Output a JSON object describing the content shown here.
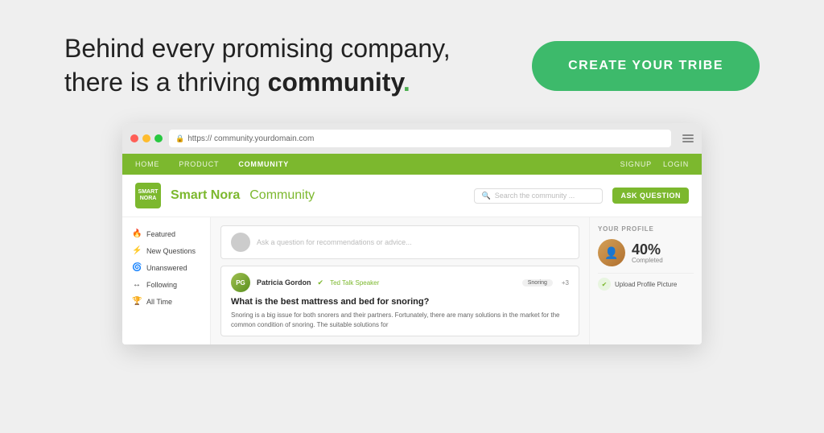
{
  "hero": {
    "headline_part1": "Behind every promising company,",
    "headline_part2": "there is a thriving ",
    "headline_bold": "community",
    "headline_dot": ".",
    "cta_label": "CREATE YOUR TRIBE"
  },
  "browser": {
    "url": "https:// community.yourdomain.com",
    "dots": [
      "red",
      "yellow",
      "green"
    ]
  },
  "site": {
    "logo_text": "SMART\nNORA",
    "title": "Smart Nora",
    "community_label": "Community",
    "search_placeholder": "Search the community ...",
    "ask_button": "ASK QUESTION",
    "nav": {
      "items": [
        {
          "label": "HOME",
          "active": false
        },
        {
          "label": "PRODUCT",
          "active": false
        },
        {
          "label": "COMMUNITY",
          "active": true
        }
      ],
      "right_items": [
        {
          "label": "SIGNUP",
          "active": false
        },
        {
          "label": "LOGIN",
          "active": false
        }
      ]
    },
    "sidebar": {
      "items": [
        {
          "icon": "🔥",
          "label": "Featured"
        },
        {
          "icon": "⚡",
          "label": "New Questions"
        },
        {
          "icon": "🌀",
          "label": "Unanswered"
        },
        {
          "icon": "↔",
          "label": "Following"
        },
        {
          "icon": "🏆",
          "label": "All Time"
        }
      ]
    },
    "ask_prompt": "Ask a question for recommendations or advice...",
    "question": {
      "author": "Patricia Gordon",
      "verified": true,
      "author_badge": "Ted Talk Speaker",
      "tag": "Snoring",
      "tag_extra": "+3",
      "title": "What is the best mattress and bed for snoring?",
      "body": "Snoring is a big issue for both snorers and their partners. Fortunately, there are many solutions in the market for the common condition of snoring. The suitable solutions for"
    },
    "profile": {
      "section_title": "YOUR PROFILE",
      "completion_percent": "40%",
      "completion_label": "Completed",
      "action_label": "Upload Profile Picture"
    }
  }
}
